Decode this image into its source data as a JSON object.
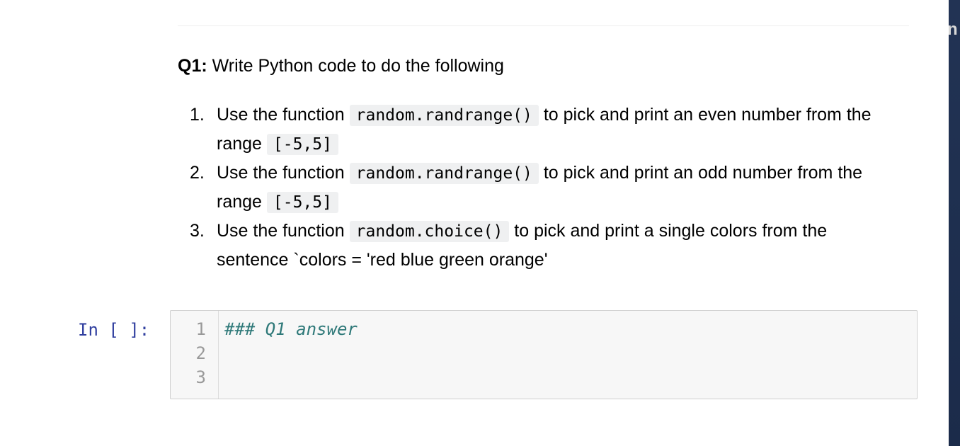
{
  "markdown_cell": {
    "heading_label": "Q1:",
    "heading_text": " Write Python code to do the following",
    "items": [
      {
        "number": "1.",
        "before": "Use the function ",
        "code": "random.randrange()",
        "after": " to pick and print an even number from the range ",
        "code2": "[-5,5]"
      },
      {
        "number": "2.",
        "before": "Use the function ",
        "code": "random.randrange()",
        "after": " to pick and print an odd number from the range ",
        "code2": "[-5,5]"
      },
      {
        "number": "3.",
        "before": "Use the function ",
        "code": "random.choice()",
        "after": " to pick and print a single colors from the sentence `colors = 'red blue green orange'"
      }
    ]
  },
  "code_cell": {
    "prompt": "In [ ]:",
    "line_numbers": [
      "1",
      "2",
      "3"
    ],
    "lines": [
      "### Q1 answer",
      "",
      ""
    ]
  },
  "side_panel": {
    "partial_text": "n"
  }
}
